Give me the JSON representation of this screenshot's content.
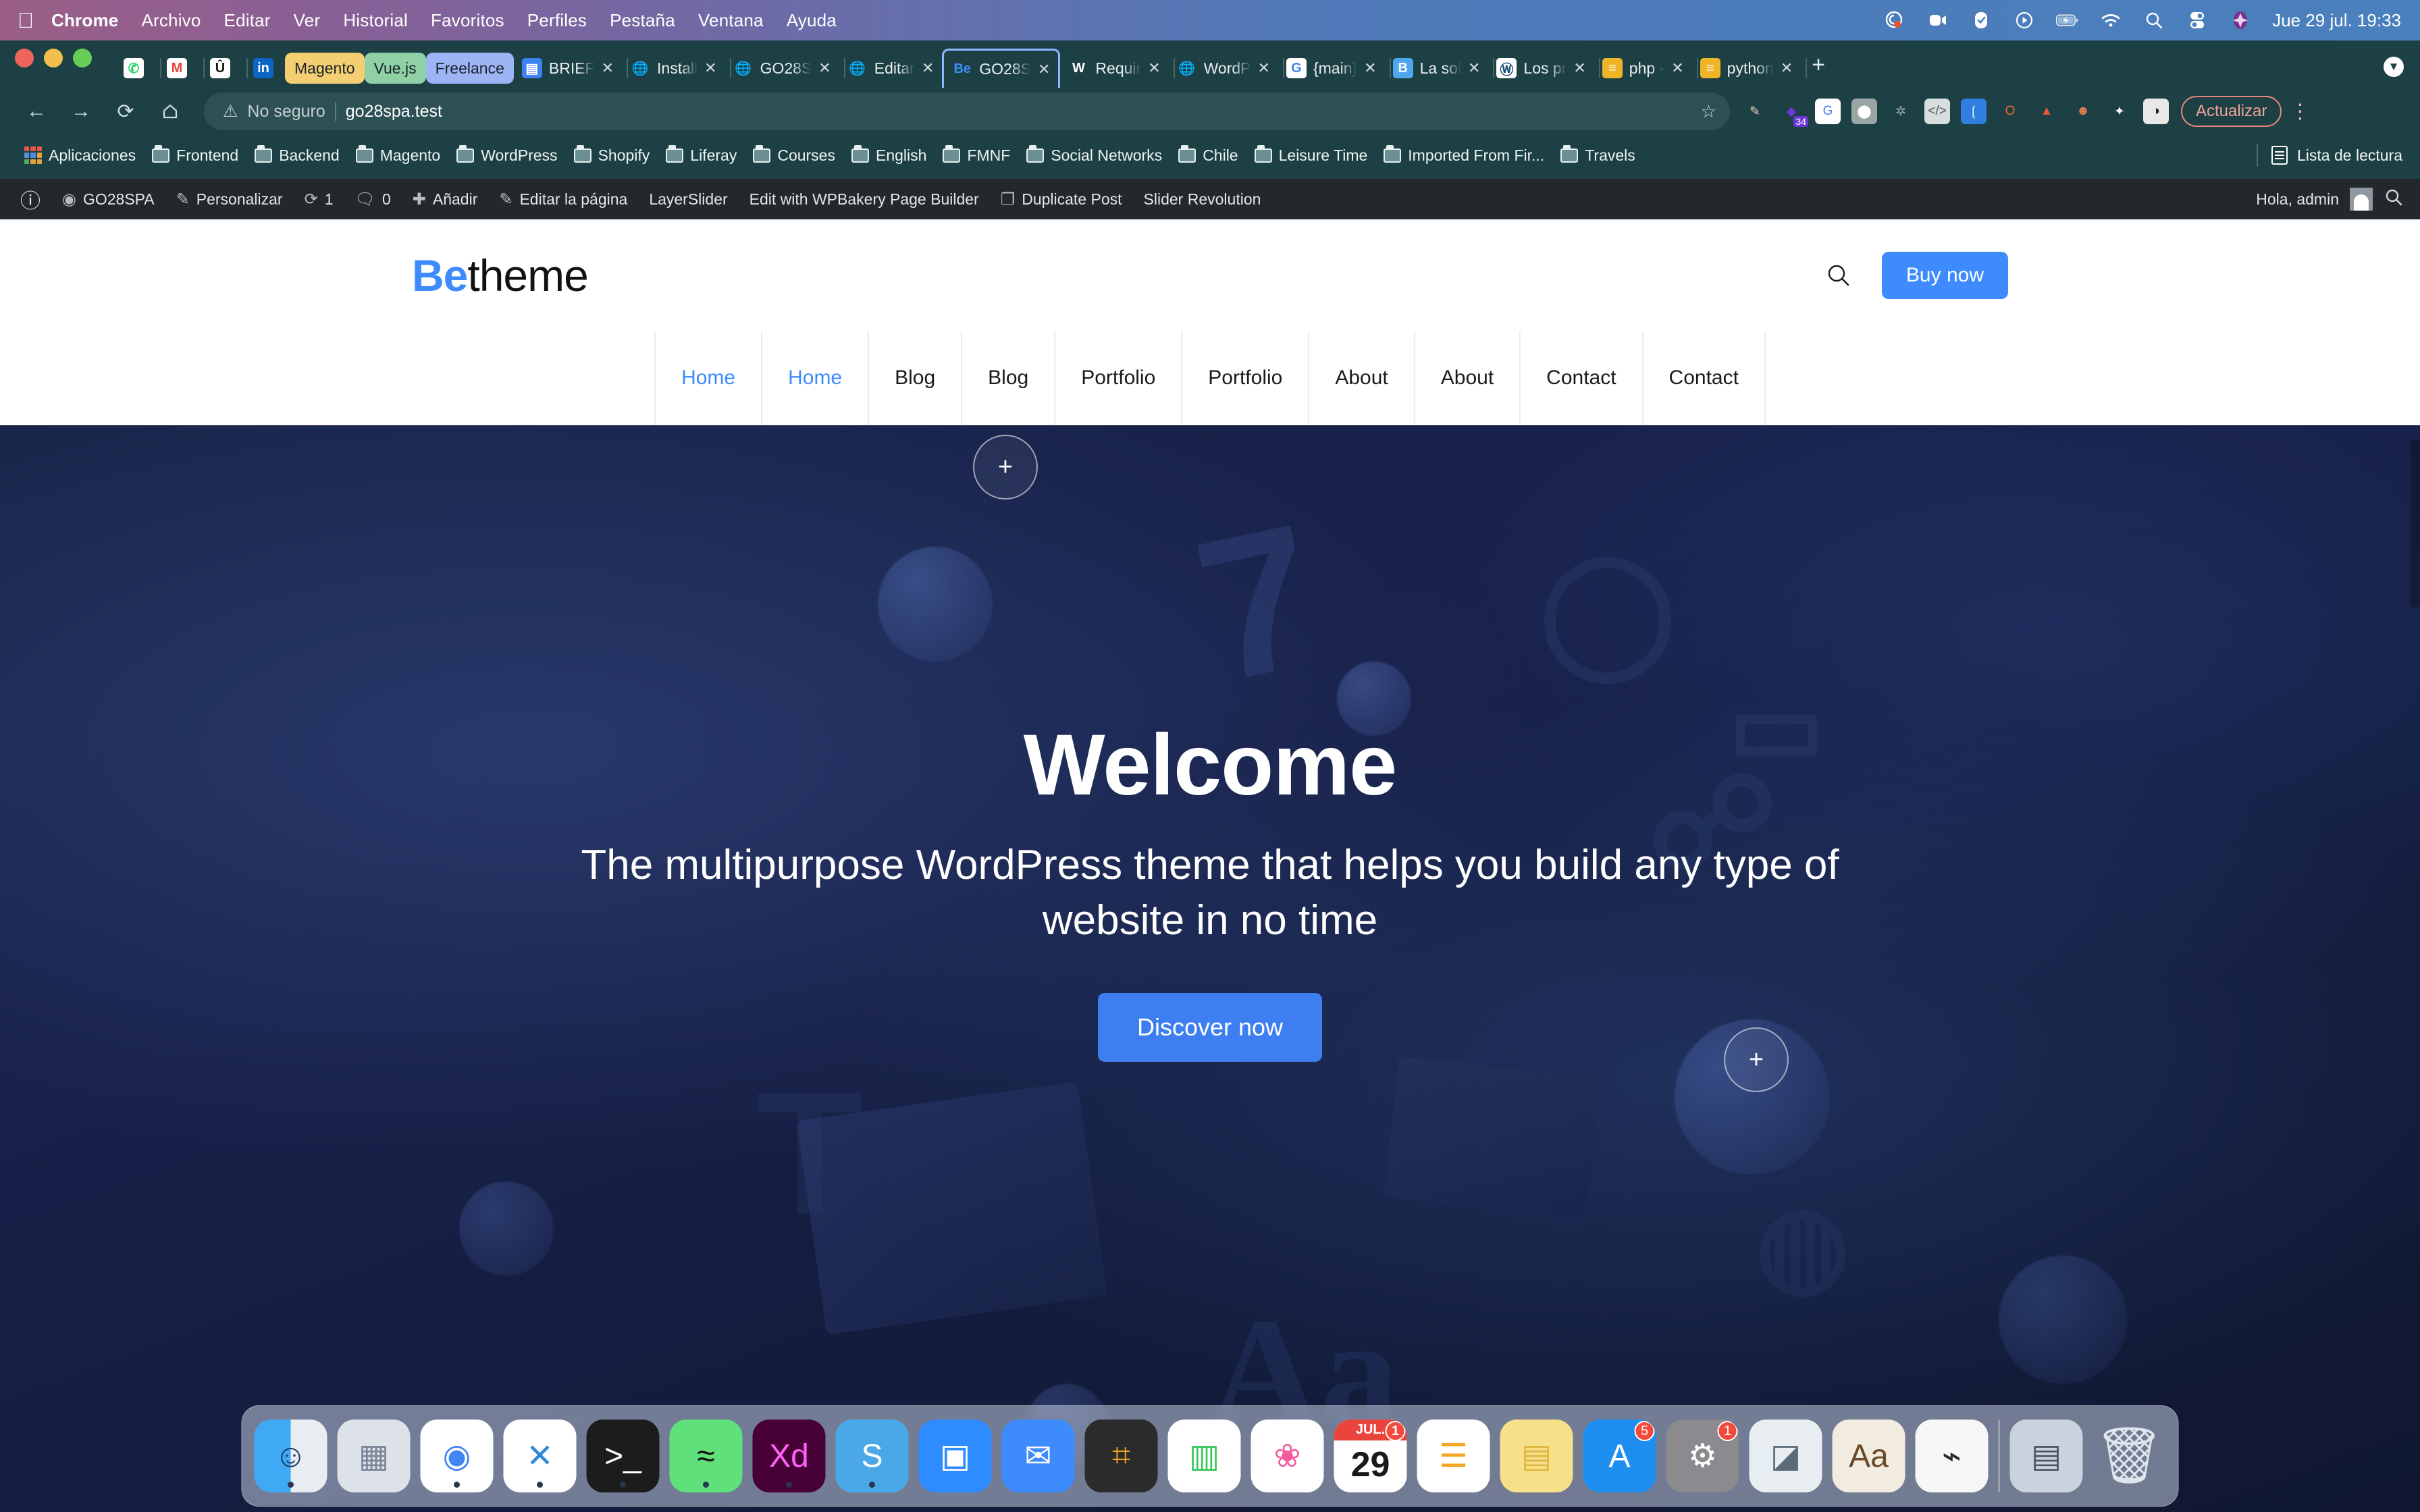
{
  "menubar": {
    "apple_icon": "apple-icon",
    "items": [
      {
        "label": "Chrome",
        "bold": true
      },
      {
        "label": "Archivo",
        "bold": false
      },
      {
        "label": "Editar",
        "bold": false
      },
      {
        "label": "Ver",
        "bold": false
      },
      {
        "label": "Historial",
        "bold": false
      },
      {
        "label": "Favoritos",
        "bold": false
      },
      {
        "label": "Perfiles",
        "bold": false
      },
      {
        "label": "Pestaña",
        "bold": false
      },
      {
        "label": "Ventana",
        "bold": false
      },
      {
        "label": "Ayuda",
        "bold": false
      }
    ],
    "status_icons": [
      "grammarly-icon",
      "zoom-icon",
      "todoist-icon",
      "play-icon",
      "battery-charging-icon",
      "wifi-icon",
      "spotlight-search-icon",
      "control-center-icon",
      "app-icon"
    ],
    "clock": "Jue 29 jul.  19:33"
  },
  "chrome": {
    "window_controls": [
      "close",
      "minimize",
      "zoom"
    ],
    "pinned_tabs": [
      {
        "name": "whatsapp-icon",
        "glyph": "✆",
        "bg": "#ffffff",
        "fg": "#25d366"
      },
      {
        "name": "gmail-icon",
        "glyph": "M",
        "bg": "#ffffff",
        "fg": "#ea4335"
      },
      {
        "name": "ubersuggest-icon",
        "glyph": "Û",
        "bg": "#ffffff",
        "fg": "#1a1a1a"
      },
      {
        "name": "linkedin-icon",
        "glyph": "in",
        "bg": "#0a66c2",
        "fg": "#ffffff"
      }
    ],
    "tab_groups": [
      {
        "label": "Magento",
        "color": "#f3cf72"
      },
      {
        "label": "Vue.js",
        "color": "#8fd1a5"
      },
      {
        "label": "Freelance",
        "color": "#9db4f5"
      }
    ],
    "tabs": [
      {
        "label": "BRIEF",
        "favicon": "docs-icon",
        "glyph": "▤",
        "bg": "#3d82f5",
        "fg": "#ffffff",
        "active": false
      },
      {
        "label": "Install",
        "favicon": "globe-icon",
        "glyph": "🌐",
        "bg": "transparent",
        "fg": "#ffffff",
        "active": false
      },
      {
        "label": "GO28S",
        "favicon": "globe-icon",
        "glyph": "🌐",
        "bg": "transparent",
        "fg": "#ffffff",
        "active": false
      },
      {
        "label": "Editar",
        "favicon": "globe-icon",
        "glyph": "🌐",
        "bg": "transparent",
        "fg": "#ffffff",
        "active": false
      },
      {
        "label": "GO28S",
        "favicon": "betheme-icon",
        "glyph": "Be",
        "bg": "transparent",
        "fg": "#3d8bfd",
        "active": true
      },
      {
        "label": "Requir",
        "favicon": "wordpress-icon",
        "glyph": "W",
        "bg": "transparent",
        "fg": "#ffffff",
        "active": false
      },
      {
        "label": "WordP",
        "favicon": "globe-icon",
        "glyph": "🌐",
        "bg": "transparent",
        "fg": "#ffffff",
        "active": false
      },
      {
        "label": "{main}",
        "favicon": "google-icon",
        "glyph": "G",
        "bg": "#ffffff",
        "fg": "#4285f4",
        "active": false
      },
      {
        "label": "La sol",
        "favicon": "bootstrap-icon",
        "glyph": "B",
        "bg": "#4fa8ef",
        "fg": "#ffffff",
        "active": false
      },
      {
        "label": "Los pr",
        "favicon": "wordpress-vip-icon",
        "glyph": "Ⓦ",
        "bg": "#ffffff",
        "fg": "#1a4a7a",
        "active": false
      },
      {
        "label": "php -",
        "favicon": "php-docs-icon",
        "glyph": "≡",
        "bg": "#f0b429",
        "fg": "#ffffff",
        "active": false
      },
      {
        "label": "python",
        "favicon": "python-docs-icon",
        "glyph": "≡",
        "bg": "#f0b429",
        "fg": "#ffffff",
        "active": false
      }
    ],
    "tab_close_label": "✕",
    "new_tab_label": "+",
    "tab_list_icon": "chevron-down-icon",
    "nav": {
      "back": "←",
      "forward": "→",
      "reload": "⟳",
      "home": "⌂"
    },
    "omnibox": {
      "security_icon": "warning-triangle-icon",
      "security_label": "No seguro",
      "url": "go28spa.test",
      "bookmark_icon": "star-icon"
    },
    "extensions": [
      {
        "name": "eyedropper-extension",
        "glyph": "✎",
        "bg": "transparent",
        "fg": "#e8d2c0"
      },
      {
        "name": "gemini-extension",
        "glyph": "◆",
        "bg": "transparent",
        "fg": "#6b38d8",
        "badge": "34"
      },
      {
        "name": "google-translate-extension",
        "glyph": "G",
        "bg": "#ffffff",
        "fg": "#4285f4"
      },
      {
        "name": "lastpass-extension",
        "glyph": "⬤",
        "bg": "#9aa5a5",
        "fg": "#ffffff"
      },
      {
        "name": "settings-gear-extension",
        "glyph": "✲",
        "bg": "transparent",
        "fg": "#9aa5a5"
      },
      {
        "name": "code-inspector-extension",
        "glyph": "</>",
        "bg": "#d7dede",
        "fg": "#4a5555"
      },
      {
        "name": "json-viewer-extension",
        "glyph": "❲",
        "bg": "#2f7fe0",
        "fg": "#ffffff"
      },
      {
        "name": "opera-touch-extension",
        "glyph": "O",
        "bg": "transparent",
        "fg": "#f06a2a"
      },
      {
        "name": "fire-extension",
        "glyph": "▲",
        "bg": "transparent",
        "fg": "#e8553c"
      },
      {
        "name": "hotjar-extension",
        "glyph": "☻",
        "bg": "transparent",
        "fg": "#e8814a"
      },
      {
        "name": "puzzle-extensions-icon",
        "glyph": "✦",
        "bg": "transparent",
        "fg": "#ffffff"
      },
      {
        "name": "profile-avatar",
        "glyph": "◑",
        "bg": "#e8e8e8",
        "fg": "#1a1a1a"
      }
    ],
    "update_label": "Actualizar",
    "menu_icon": "three-dot-menu-icon",
    "bookmarks": [
      {
        "label": "Aplicaciones",
        "icon": "apps-grid-icon"
      },
      {
        "label": "Frontend",
        "icon": "folder-icon"
      },
      {
        "label": "Backend",
        "icon": "folder-icon"
      },
      {
        "label": "Magento",
        "icon": "folder-icon"
      },
      {
        "label": "WordPress",
        "icon": "folder-icon"
      },
      {
        "label": "Shopify",
        "icon": "folder-icon"
      },
      {
        "label": "Liferay",
        "icon": "folder-icon"
      },
      {
        "label": "Courses",
        "icon": "folder-icon"
      },
      {
        "label": "English",
        "icon": "folder-icon"
      },
      {
        "label": "FMNF",
        "icon": "folder-icon"
      },
      {
        "label": "Social Networks",
        "icon": "folder-icon"
      },
      {
        "label": "Chile",
        "icon": "folder-icon"
      },
      {
        "label": "Leisure Time",
        "icon": "folder-icon"
      },
      {
        "label": "Imported From Fir...",
        "icon": "folder-icon"
      },
      {
        "label": "Travels",
        "icon": "folder-icon"
      }
    ],
    "reading_list_label": "Lista de lectura"
  },
  "wp_admin_bar": {
    "logo_icon": "wordpress-logo-icon",
    "items": [
      {
        "label": "GO28SPA",
        "icon": "dashboard-icon"
      },
      {
        "label": "Personalizar",
        "icon": "paintbrush-icon"
      },
      {
        "label": "1",
        "icon": "updates-icon"
      },
      {
        "label": "0",
        "icon": "comment-bubble-icon"
      },
      {
        "label": "Añadir",
        "icon": "plus-icon"
      },
      {
        "label": "Editar la página",
        "icon": "pencil-icon"
      },
      {
        "label": "LayerSlider",
        "icon": ""
      },
      {
        "label": "Edit with WPBakery Page Builder",
        "icon": ""
      },
      {
        "label": "Duplicate Post",
        "icon": "duplicate-icon"
      },
      {
        "label": "Slider Revolution",
        "icon": ""
      }
    ],
    "greeting": "Hola, admin",
    "avatar_icon": "user-avatar-icon",
    "search_icon": "search-icon"
  },
  "site": {
    "logo": {
      "bold": "Be",
      "light": "theme"
    },
    "search_icon": "search-icon",
    "buy_now_label": "Buy now",
    "nav": [
      {
        "label": "Home",
        "active": true
      },
      {
        "label": "Home",
        "active": true
      },
      {
        "label": "Blog",
        "active": false
      },
      {
        "label": "Blog",
        "active": false
      },
      {
        "label": "Portfolio",
        "active": false
      },
      {
        "label": "Portfolio",
        "active": false
      },
      {
        "label": "About",
        "active": false
      },
      {
        "label": "About",
        "active": false
      },
      {
        "label": "Contact",
        "active": false
      },
      {
        "label": "Contact",
        "active": false
      }
    ],
    "hero": {
      "title": "Welcome",
      "subtitle": "The multipurpose WordPress theme that helps you build any type of website in no time",
      "cta_label": "Discover now",
      "plus_label": "+",
      "accent_color": "#3d7ff0"
    }
  },
  "dock": {
    "items": [
      {
        "name": "finder-icon",
        "glyph": "☺",
        "bg": "linear-gradient(90deg,#3fa9f5 50%, #e9edf2 50%)",
        "fg": "#1c3f6e",
        "running": true
      },
      {
        "name": "launchpad-icon",
        "glyph": "▦",
        "bg": "#dde2ea",
        "fg": "#7a8494",
        "running": false
      },
      {
        "name": "google-chrome-icon",
        "glyph": "◉",
        "bg": "#ffffff",
        "fg": "#4285f4",
        "running": true
      },
      {
        "name": "vscode-icon",
        "glyph": "✕",
        "bg": "#ffffff",
        "fg": "#2d8ad6",
        "running": true
      },
      {
        "name": "terminal-icon",
        "glyph": ">_",
        "bg": "#1c1c1c",
        "fg": "#ffffff",
        "running": true
      },
      {
        "name": "spotify-icon",
        "glyph": "≈",
        "bg": "#5fe07a",
        "fg": "#111111",
        "running": true
      },
      {
        "name": "adobe-xd-icon",
        "glyph": "Xd",
        "bg": "#470137",
        "fg": "#ff61f6",
        "running": true
      },
      {
        "name": "skype-icon",
        "glyph": "S",
        "bg": "#4aa8e8",
        "fg": "#ffffff",
        "running": true
      },
      {
        "name": "zoom-icon",
        "glyph": "▣",
        "bg": "#2d8cff",
        "fg": "#ffffff",
        "running": false
      },
      {
        "name": "mail-icon",
        "glyph": "✉",
        "bg": "#3d8bfd",
        "fg": "#ffffff",
        "running": false
      },
      {
        "name": "calculator-icon",
        "glyph": "⌗",
        "bg": "#2b2b2b",
        "fg": "#f5a623",
        "running": false
      },
      {
        "name": "numbers-icon",
        "glyph": "▥",
        "bg": "#ffffff",
        "fg": "#35c759",
        "running": false
      },
      {
        "name": "photos-icon",
        "glyph": "❀",
        "bg": "#ffffff",
        "fg": "#f25b9c",
        "running": false
      },
      {
        "name": "calendar-icon",
        "glyph": "29",
        "bg": "#ffffff",
        "fg": "#1a1a1a",
        "running": false,
        "badge": "1",
        "month": "JUL."
      },
      {
        "name": "reminders-icon",
        "glyph": "☰",
        "bg": "#ffffff",
        "fg": "#f5a623",
        "running": false
      },
      {
        "name": "notes-icon",
        "glyph": "▤",
        "bg": "#f7e08a",
        "fg": "#e0b640",
        "running": false
      },
      {
        "name": "app-store-icon",
        "glyph": "A",
        "bg": "#1d8ef0",
        "fg": "#ffffff",
        "running": false,
        "badge": "5"
      },
      {
        "name": "system-preferences-icon",
        "glyph": "⚙",
        "bg": "#8a8a8f",
        "fg": "#ffffff",
        "running": false,
        "badge": "1"
      },
      {
        "name": "preview-icon",
        "glyph": "◪",
        "bg": "#e8edf2",
        "fg": "#5a6b7a",
        "running": false
      },
      {
        "name": "font-book-icon",
        "glyph": "Aa",
        "bg": "#f2ece0",
        "fg": "#6b4a2a",
        "running": false
      },
      {
        "name": "sequel-pro-icon",
        "glyph": "⌁",
        "bg": "#f7f7f7",
        "fg": "#2a2a2a",
        "running": false
      },
      {
        "name": "downloads-stack-icon",
        "glyph": "▤",
        "bg": "#c9d2dd",
        "fg": "#4a5560",
        "running": false
      },
      {
        "name": "trash-icon",
        "glyph": "🗑",
        "bg": "transparent",
        "fg": "#dfe6ee",
        "running": false
      }
    ]
  }
}
